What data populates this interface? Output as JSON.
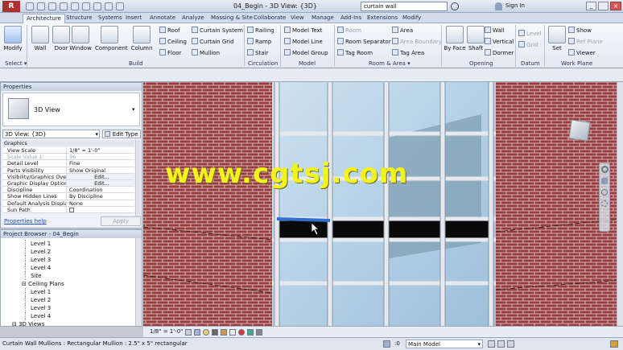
{
  "titlebar": {
    "title": "04_Begin - 3D View: {3D}",
    "search_value": "curtain wall",
    "sign_in": "Sign In"
  },
  "tabs": [
    "Architecture",
    "Structure",
    "Systems",
    "Insert",
    "Annotate",
    "Analyze",
    "Massing & Site",
    "Collaborate",
    "View",
    "Manage",
    "Add-Ins",
    "Extensions",
    "Modify"
  ],
  "ribbon": {
    "modify": "Modify",
    "select": "Select ▾",
    "build": {
      "label": "Build",
      "wall": "Wall",
      "door": "Door",
      "window": "Window",
      "component": "Component",
      "column": "Column",
      "roof": "Roof",
      "ceiling": "Ceiling",
      "floor": "Floor",
      "curtain_system": "Curtain System",
      "curtain_grid": "Curtain Grid",
      "mullion": "Mullion"
    },
    "circulation": {
      "label": "Circulation",
      "railing": "Railing",
      "ramp": "Ramp",
      "stair": "Stair"
    },
    "model": {
      "label": "Model",
      "model_text": "Model Text",
      "model_line": "Model Line",
      "model_group": "Model Group"
    },
    "room_area": {
      "label": "Room & Area ▾",
      "room": "Room",
      "room_separator": "Room Separator",
      "tag_room": "Tag Room",
      "area": "Area",
      "area_boundary": "Area Boundary",
      "tag_area": "Tag Area"
    },
    "opening": {
      "label": "Opening",
      "by_face": "By Face",
      "shaft": "Shaft",
      "wall": "Wall",
      "vertical": "Vertical",
      "dormer": "Dormer"
    },
    "datum": {
      "label": "Datum",
      "level": "Level",
      "grid": "Grid"
    },
    "work_plane": {
      "label": "Work Plane",
      "set": "Set",
      "show": "Show",
      "ref_plane": "Ref Plane",
      "viewer": "Viewer"
    }
  },
  "properties": {
    "header": "Properties",
    "type_name": "3D View",
    "selector": "3D View: {3D}",
    "edit_type": "Edit Type",
    "section": "Graphics",
    "rows": [
      {
        "k": "View Scale",
        "v": "1/8\" = 1'-0\""
      },
      {
        "k": "Scale Value    1:",
        "v": "96"
      },
      {
        "k": "Detail Level",
        "v": "Fine"
      },
      {
        "k": "Parts Visibility",
        "v": "Show Original"
      },
      {
        "k": "Visibility/Graphics Over...",
        "v": "Edit..."
      },
      {
        "k": "Graphic Display Options",
        "v": "Edit..."
      },
      {
        "k": "Discipline",
        "v": "Coordination"
      },
      {
        "k": "Show Hidden Lines",
        "v": "By Discipline"
      },
      {
        "k": "Default Analysis Displa...",
        "v": "None"
      },
      {
        "k": "Sun Path",
        "v": ""
      }
    ],
    "help": "Properties help",
    "apply": "Apply"
  },
  "browser": {
    "header": "Project Browser - 04_Begin",
    "items": [
      {
        "label": "Level 1",
        "indent": 3
      },
      {
        "label": "Level 2",
        "indent": 3
      },
      {
        "label": "Level 3",
        "indent": 3
      },
      {
        "label": "Level 4",
        "indent": 3
      },
      {
        "label": "Site",
        "indent": 3
      },
      {
        "label": "Ceiling Plans",
        "indent": 2
      },
      {
        "label": "Level 1",
        "indent": 3
      },
      {
        "label": "Level 2",
        "indent": 3
      },
      {
        "label": "Level 3",
        "indent": 3
      },
      {
        "label": "Level 4",
        "indent": 3
      },
      {
        "label": "3D Views",
        "indent": 1
      }
    ]
  },
  "viewbar": {
    "scale": "1/8\" = 1'-0\""
  },
  "status": {
    "text": "Curtain Wall Mullions : Rectangular Mullion : 2.5\" x 5\" rectangular",
    "value": ":0",
    "model": "Main Model"
  },
  "watermark": "www.cgtsj.com",
  "colors": {
    "brick": "#9b3b3b",
    "glass": "#b6d3e8",
    "mullion": "#e6e9ee",
    "accent": "#2f6fd1"
  }
}
